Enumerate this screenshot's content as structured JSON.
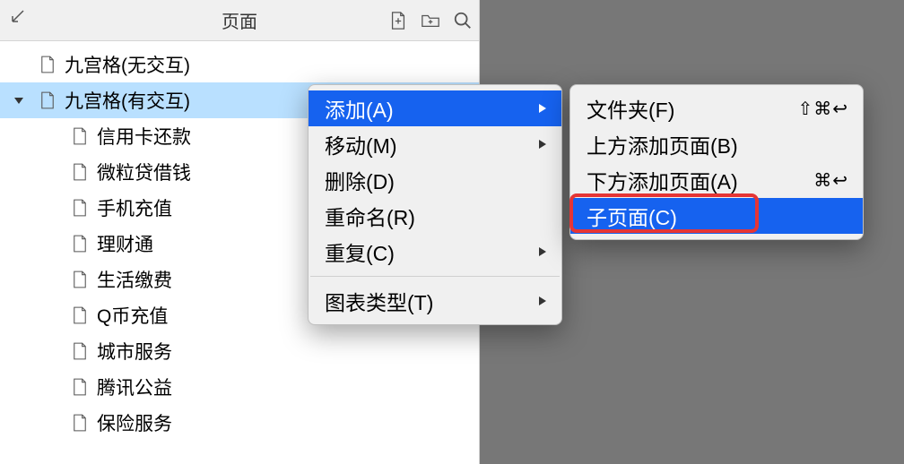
{
  "panel": {
    "title": "页面"
  },
  "tree": [
    {
      "label": "九宫格(无交互)",
      "level": 0
    },
    {
      "label": "九宫格(有交互)",
      "level": 0,
      "expanded": true,
      "selected": true
    },
    {
      "label": "信用卡还款",
      "level": 1
    },
    {
      "label": "微粒贷借钱",
      "level": 1
    },
    {
      "label": "手机充值",
      "level": 1
    },
    {
      "label": "理财通",
      "level": 1
    },
    {
      "label": "生活缴费",
      "level": 1
    },
    {
      "label": "Q币充值",
      "level": 1
    },
    {
      "label": "城市服务",
      "level": 1
    },
    {
      "label": "腾讯公益",
      "level": 1
    },
    {
      "label": "保险服务",
      "level": 1
    }
  ],
  "menu1": {
    "items": [
      {
        "label": "添加(A)",
        "submenu": true,
        "highlight": true
      },
      {
        "label": "移动(M)",
        "submenu": true
      },
      {
        "label": "删除(D)"
      },
      {
        "label": "重命名(R)"
      },
      {
        "label": "重复(C)",
        "submenu": true
      }
    ],
    "items2": [
      {
        "label": "图表类型(T)",
        "submenu": true
      }
    ]
  },
  "menu2": {
    "items": [
      {
        "label": "文件夹(F)",
        "shortcut": "⇧⌘↩"
      },
      {
        "label": "上方添加页面(B)"
      },
      {
        "label": "下方添加页面(A)",
        "shortcut": "⌘↩"
      },
      {
        "label": "子页面(C)",
        "highlight": true
      }
    ]
  }
}
